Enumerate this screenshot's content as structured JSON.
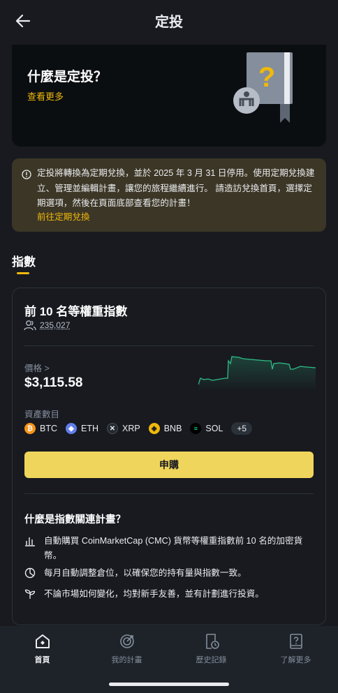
{
  "header": {
    "title": "定投"
  },
  "banner": {
    "title": "什麼是定投？",
    "link": "查看更多"
  },
  "notice": {
    "text": "定投將轉換為定期兌換，並於 2025 年 3 月 31 日停用。使用定期兌換建立、管理並編輯計畫，讓您的旅程繼續進行。 請造訪兌換首頁，選擇定期選項，然後在頁面底部查看您的計畫！",
    "link": "前往定期兌換"
  },
  "tabs": {
    "active": "指數"
  },
  "card": {
    "title": "前 10 名等權重指數",
    "users": "235,027",
    "price_label": "價格 >",
    "price": "$3,115.58",
    "assets_label": "資產數目",
    "assets": [
      {
        "symbol": "BTC",
        "color": "#f7931a"
      },
      {
        "symbol": "ETH",
        "color": "#627eea"
      },
      {
        "symbol": "XRP",
        "color": "#23292f"
      },
      {
        "symbol": "BNB",
        "color": "#f0b90b"
      },
      {
        "symbol": "SOL",
        "color": "#14f195"
      }
    ],
    "more_assets": "+5",
    "subscribe": "申購",
    "what_title": "什麼是指數關連計畫？",
    "features": [
      {
        "icon": "bar-chart-icon",
        "text": "自動購買 CoinMarketCap (CMC) 貨幣等權重指數前 10 名的加密貨幣。"
      },
      {
        "icon": "pie-chart-icon",
        "text": "每月自動調整倉位，以確保您的持有量與指數一致。"
      },
      {
        "icon": "sprout-icon",
        "text": "不論市場如何變化，均對新手友善，並有計劃進行投資。"
      }
    ]
  },
  "nav": {
    "items": [
      {
        "label": "首頁",
        "icon": "home-icon"
      },
      {
        "label": "我的計畫",
        "icon": "target-icon"
      },
      {
        "label": "歷史記錄",
        "icon": "history-icon"
      },
      {
        "label": "了解更多",
        "icon": "help-book-icon"
      }
    ]
  },
  "colors": {
    "accent": "#f0b90b",
    "button": "#f0d55c",
    "up": "#2ebd85"
  }
}
